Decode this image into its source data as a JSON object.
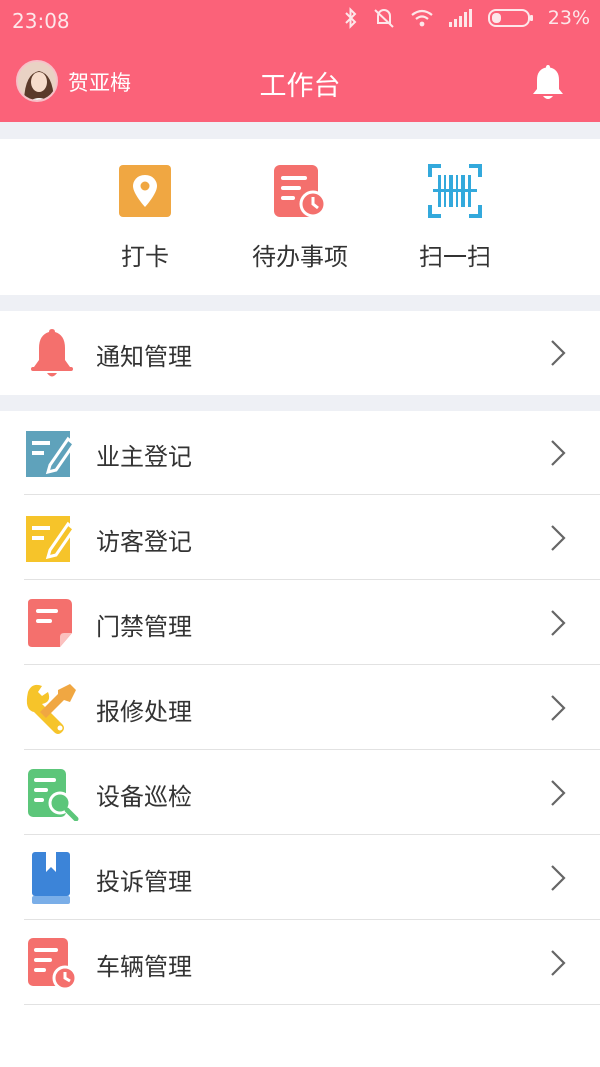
{
  "status_bar": {
    "time": "23:08",
    "battery": "23%",
    "icons": [
      "bluetooth-icon",
      "mute-icon",
      "wifi-icon",
      "signal-icon",
      "battery-icon"
    ]
  },
  "header": {
    "user_name": "贺亚梅",
    "title": "工作台",
    "bell_icon": "bell-icon",
    "background": "#fb6279"
  },
  "quick_actions": [
    {
      "label": "打卡",
      "icon": "location-pin-icon",
      "color": "#f0a742"
    },
    {
      "label": "待办事项",
      "icon": "todo-clock-icon",
      "color": "#f4706d"
    },
    {
      "label": "扫一扫",
      "icon": "barcode-scan-icon",
      "color": "#33a9dc"
    }
  ],
  "notice": {
    "label": "通知管理",
    "icon": "bell-icon",
    "color": "#f4706d"
  },
  "menu": [
    {
      "label": "业主登记",
      "icon": "owner-register-icon",
      "color": "#5fa2bb"
    },
    {
      "label": "访客登记",
      "icon": "visitor-register-icon",
      "color": "#f6c42a"
    },
    {
      "label": "门禁管理",
      "icon": "access-control-icon",
      "color": "#f4706d"
    },
    {
      "label": "报修处理",
      "icon": "repair-tools-icon",
      "color": "#f6c42a"
    },
    {
      "label": "设备巡检",
      "icon": "equipment-inspect-icon",
      "color": "#5cc67a"
    },
    {
      "label": "投诉管理",
      "icon": "complaint-book-icon",
      "color": "#3c84d8"
    },
    {
      "label": "车辆管理",
      "icon": "vehicle-doc-icon",
      "color": "#f4706d"
    }
  ]
}
